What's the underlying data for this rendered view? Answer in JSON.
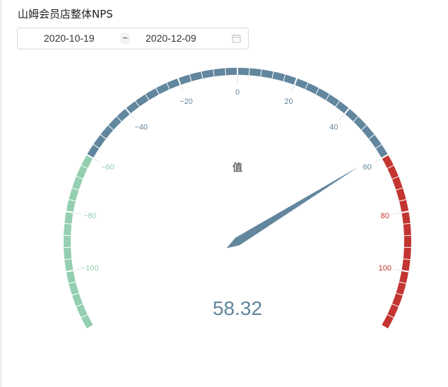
{
  "page_title": "山姆会员店整体NPS",
  "date_range": {
    "start": "2020-10-19",
    "separator": "~",
    "end": "2020-12-09",
    "icon": "calendar-icon"
  },
  "chart_data": {
    "type": "gauge",
    "title": "值",
    "value": 58.32,
    "value_label": "58.32",
    "min": -120,
    "max": 120,
    "tick_labels": [
      {
        "value": -100,
        "label": "−100"
      },
      {
        "value": -80,
        "label": "−80"
      },
      {
        "value": -60,
        "label": "−60"
      },
      {
        "value": -40,
        "label": "−40"
      },
      {
        "value": -20,
        "label": "−20"
      },
      {
        "value": 0,
        "label": "0"
      },
      {
        "value": 20,
        "label": "20"
      },
      {
        "value": 40,
        "label": "40"
      },
      {
        "value": 60,
        "label": "60"
      },
      {
        "value": 80,
        "label": "80"
      },
      {
        "value": 100,
        "label": "100"
      }
    ],
    "bands": [
      {
        "from": -120,
        "to": -60,
        "color": "#93cfb0"
      },
      {
        "from": -60,
        "to": 60,
        "color": "#62869e"
      },
      {
        "from": 60,
        "to": 120,
        "color": "#c23531"
      }
    ],
    "pointer_color": "#62869e"
  }
}
